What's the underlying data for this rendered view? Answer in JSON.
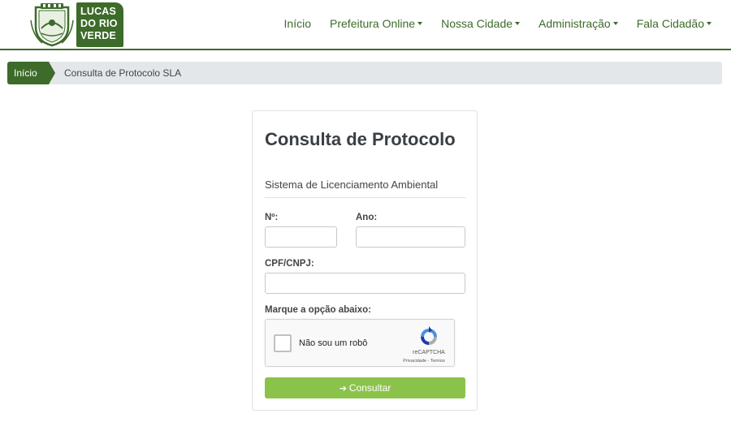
{
  "header": {
    "logo_text": [
      "LUCAS",
      "DO RIO",
      "VERDE"
    ],
    "brand_color": "#3d6b2a",
    "nav": [
      {
        "label": "Início",
        "dropdown": false
      },
      {
        "label": "Prefeitura Online",
        "dropdown": true
      },
      {
        "label": "Nossa Cidade",
        "dropdown": true
      },
      {
        "label": "Administração",
        "dropdown": true
      },
      {
        "label": "Fala Cidadão",
        "dropdown": true
      }
    ]
  },
  "breadcrumb": {
    "home": "Início",
    "current": "Consulta de Protocolo SLA"
  },
  "form": {
    "title": "Consulta de Protocolo",
    "subtitle": "Sistema de Licenciamento Ambiental",
    "numero_label": "Nº:",
    "numero_value": "",
    "ano_label": "Ano:",
    "ano_value": "",
    "cpf_label": "CPF/CNPJ:",
    "cpf_value": "",
    "captcha_prompt": "Marque a opção abaixo:",
    "captcha": {
      "label": "Não sou um robô",
      "brand": "reCAPTCHA",
      "links": "Privacidade - Termos"
    },
    "submit_icon": "sign-in-icon",
    "submit_label": "Consultar",
    "button_color": "#8bc34a"
  }
}
